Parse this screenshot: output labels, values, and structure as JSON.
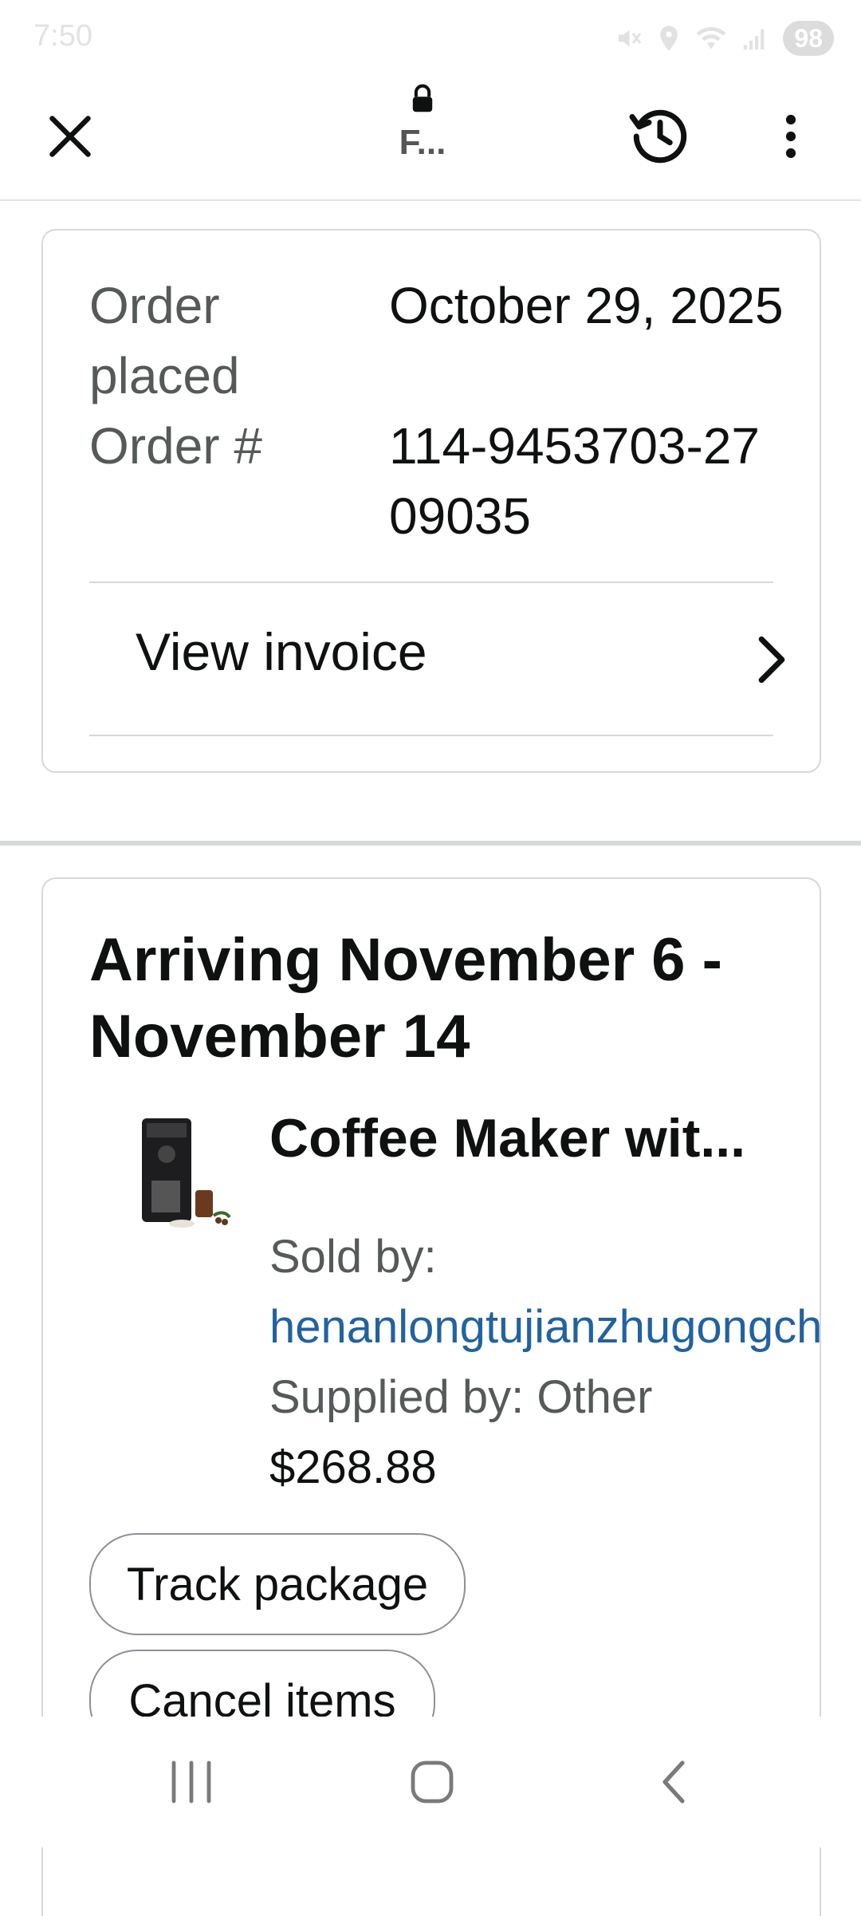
{
  "status_bar": {
    "time": "7:50",
    "battery": "98",
    "icons": [
      "mute-icon",
      "location-icon",
      "wifi-icon",
      "signal-icon",
      "battery-icon"
    ]
  },
  "toolbar": {
    "url_short": "F...",
    "icons": [
      "close-icon",
      "lock-icon",
      "history-icon",
      "more-vert-icon"
    ]
  },
  "order": {
    "placed_label": "Order placed",
    "placed_value": "October 29, 2025",
    "number_label": "Order #",
    "number_value": "114-9453703-2709035",
    "invoice_label": "View invoice"
  },
  "shipment": {
    "arrival": "Arriving November 6 - November 14",
    "item": {
      "title": "Coffee Maker wit...",
      "sold_by_label": "Sold by:",
      "seller": "henanlongtujianzhugongch",
      "supplied_by": "Supplied by: Other",
      "price": "$268.88"
    },
    "actions": {
      "track": "Track package",
      "cancel": "Cancel items"
    }
  },
  "colors": {
    "link": "#2162a1",
    "secondary_text": "#565959",
    "border": "#d5d9d9"
  }
}
